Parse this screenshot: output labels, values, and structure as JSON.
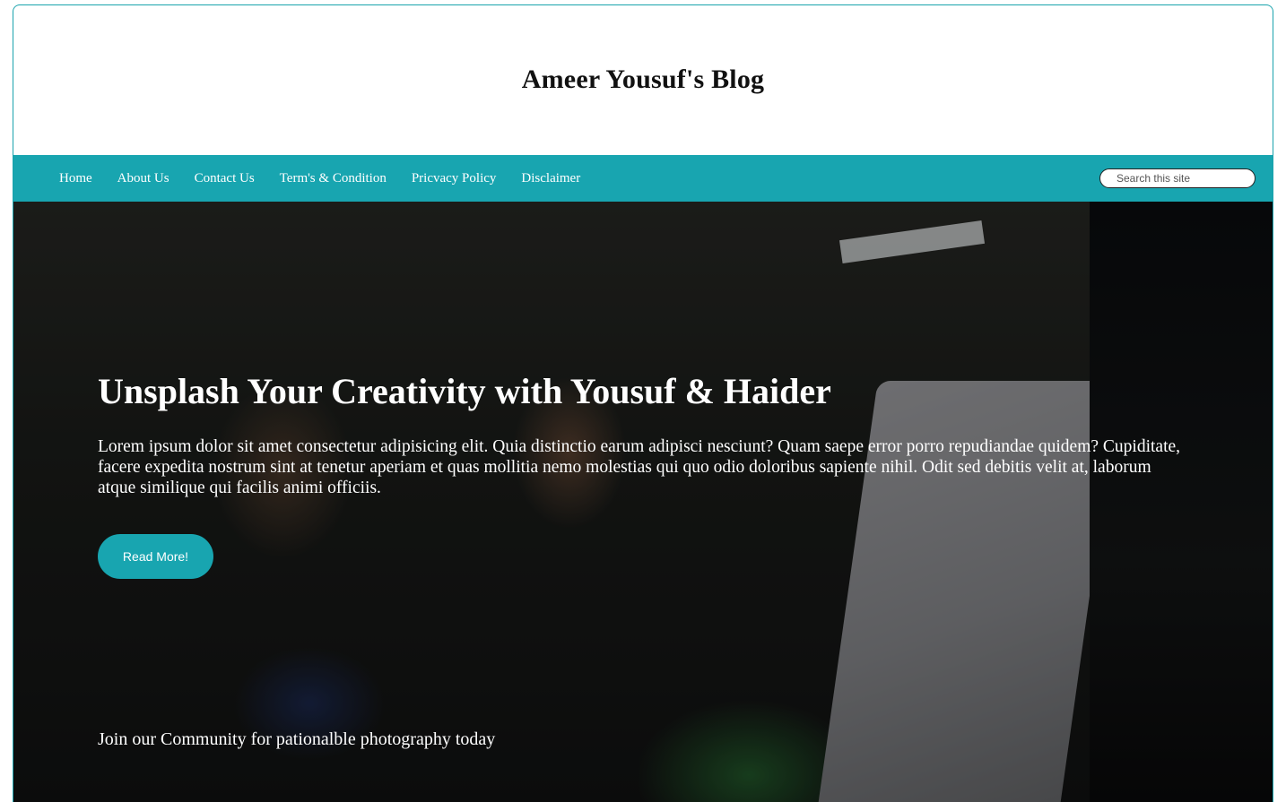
{
  "site": {
    "title": "Ameer Yousuf's Blog"
  },
  "nav": {
    "items": [
      {
        "label": "Home"
      },
      {
        "label": "About Us"
      },
      {
        "label": "Contact Us"
      },
      {
        "label": "Term's & Condition"
      },
      {
        "label": "Pricvacy Policy"
      },
      {
        "label": "Disclaimer"
      }
    ],
    "search_placeholder": "Search this site"
  },
  "hero": {
    "heading": "Unsplash Your Creativity with Yousuf & Haider",
    "text": "Lorem ipsum dolor sit amet consectetur adipisicing elit. Quia distinctio earum adipisci nesciunt? Quam saepe error porro repudiandae quidem? Cupiditate, facere expedita nostrum sint at tenetur aperiam et quas mollitia nemo molestias qui quo odio doloribus sapiente nihil. Odit sed debitis velit at, laborum atque similique qui facilis animi officiis.",
    "button_label": "Read More!",
    "footer_text": "Join our Community for pationalble photography today"
  },
  "colors": {
    "accent": "#18a5b0",
    "header_bg": "#ffffff",
    "hero_text": "#ffffff"
  }
}
